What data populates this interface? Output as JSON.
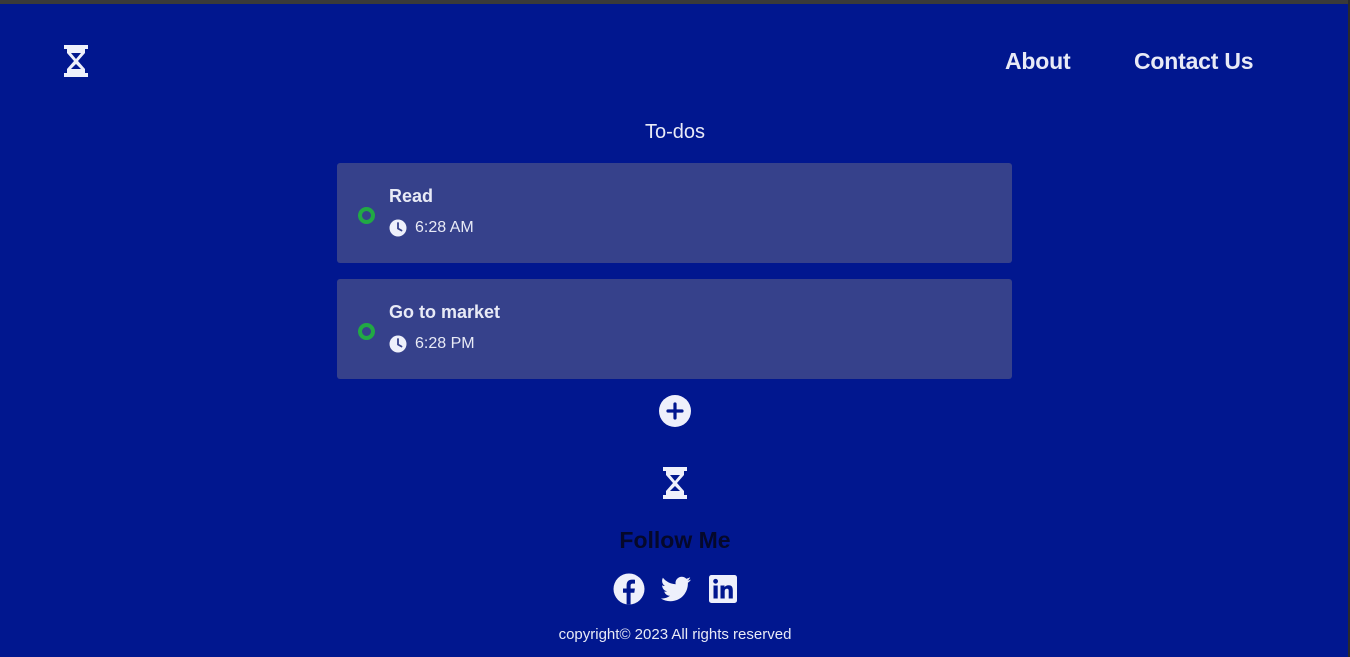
{
  "header": {
    "logo_icon": "hourglass-icon",
    "nav": [
      {
        "label": "About"
      },
      {
        "label": "Contact Us"
      }
    ]
  },
  "todos": {
    "title": "To-dos",
    "items": [
      {
        "title": "Read",
        "time": "6:28 AM",
        "status_icon": "status-ring-icon",
        "time_icon": "clock-icon"
      },
      {
        "title": "Go to market",
        "time": "6:28 PM",
        "status_icon": "status-ring-icon",
        "time_icon": "clock-icon"
      }
    ],
    "add_icon": "plus-icon"
  },
  "footer": {
    "logo_icon": "hourglass-icon",
    "follow_title": "Follow Me",
    "social_icons": [
      "facebook-icon",
      "twitter-icon",
      "linkedin-icon"
    ],
    "copyright": "copyright© 2023 All rights reserved"
  },
  "colors": {
    "background": "#01178f",
    "card": "#36418b",
    "status_green": "#21a944",
    "text_light": "#e8eaf6",
    "follow_title": "#05082a"
  }
}
